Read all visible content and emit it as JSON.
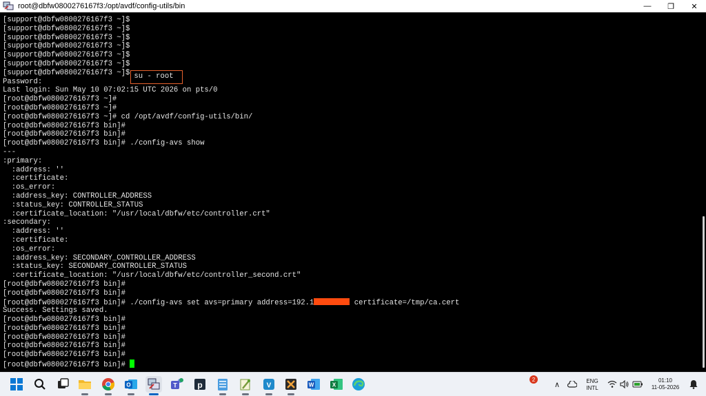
{
  "window": {
    "title": "root@dbfw0800276167f3:/opt/avdf/config-utils/bin",
    "controls": {
      "minimize": "—",
      "maximize": "❐",
      "close": "✕"
    }
  },
  "terminal": {
    "lines_before": [
      "[support@dbfw0800276167f3 ~]$",
      "[support@dbfw0800276167f3 ~]$",
      "[support@dbfw0800276167f3 ~]$",
      "[support@dbfw0800276167f3 ~]$",
      "[support@dbfw0800276167f3 ~]$",
      "[support@dbfw0800276167f3 ~]$"
    ],
    "su_prompt": "[support@dbfw0800276167f3 ~]$",
    "su_command": "su - root",
    "lines_middle": [
      "Password:",
      "Last login: Sun May 10 07:02:15 UTC 2026 on pts/0",
      "[root@dbfw0800276167f3 ~]#",
      "[root@dbfw0800276167f3 ~]#",
      "[root@dbfw0800276167f3 ~]# cd /opt/avdf/config-utils/bin/",
      "[root@dbfw0800276167f3 bin]#",
      "[root@dbfw0800276167f3 bin]#",
      "[root@dbfw0800276167f3 bin]# ./config-avs show",
      "---",
      ":primary:",
      "  :address: ''",
      "  :certificate:",
      "  :os_error:",
      "  :address_key: CONTROLLER_ADDRESS",
      "  :status_key: CONTROLLER_STATUS",
      "  :certificate_location: \"/usr/local/dbfw/etc/controller.crt\"",
      ":secondary:",
      "  :address: ''",
      "  :certificate:",
      "  :os_error:",
      "  :address_key: SECONDARY_CONTROLLER_ADDRESS",
      "  :status_key: SECONDARY_CONTROLLER_STATUS",
      "  :certificate_location: \"/usr/local/dbfw/etc/controller_second.crt\"",
      "[root@dbfw0800276167f3 bin]#",
      "[root@dbfw0800276167f3 bin]#"
    ],
    "set_command_prefix": "[root@dbfw0800276167f3 bin]# ./config-avs set avs=primary address=192.1",
    "set_command_suffix": " certificate=/tmp/ca.cert",
    "lines_after": [
      "Success. Settings saved.",
      "[root@dbfw0800276167f3 bin]#",
      "[root@dbfw0800276167f3 bin]#",
      "[root@dbfw0800276167f3 bin]#",
      "[root@dbfw0800276167f3 bin]#",
      "[root@dbfw0800276167f3 bin]#"
    ],
    "last_prompt": "[root@dbfw0800276167f3 bin]#",
    "colors": {
      "highlight_box": "#e8622d",
      "redaction": "#ff4b0f",
      "cursor": "#00ff00"
    }
  },
  "taskbar": {
    "apps": [
      {
        "icon": "windows-start-icon"
      },
      {
        "icon": "search-icon"
      },
      {
        "icon": "task-view-icon"
      },
      {
        "icon": "file-explorer-icon"
      },
      {
        "icon": "chrome-icon"
      },
      {
        "icon": "outlook-icon"
      },
      {
        "icon": "putty-icon"
      },
      {
        "icon": "teams-icon"
      },
      {
        "icon": "p-app-icon"
      },
      {
        "icon": "notepad-icon"
      },
      {
        "icon": "notepad-plus-plus-icon"
      },
      {
        "icon": "vs-app-icon"
      },
      {
        "icon": "snipping-app-icon"
      },
      {
        "icon": "word-icon"
      },
      {
        "icon": "excel-icon"
      },
      {
        "icon": "edge-icon"
      }
    ],
    "tray": {
      "notification_count": "2",
      "language_top": "ENG",
      "language_bottom": "INTL",
      "time": "01:10",
      "date": "11-05-2026"
    }
  }
}
